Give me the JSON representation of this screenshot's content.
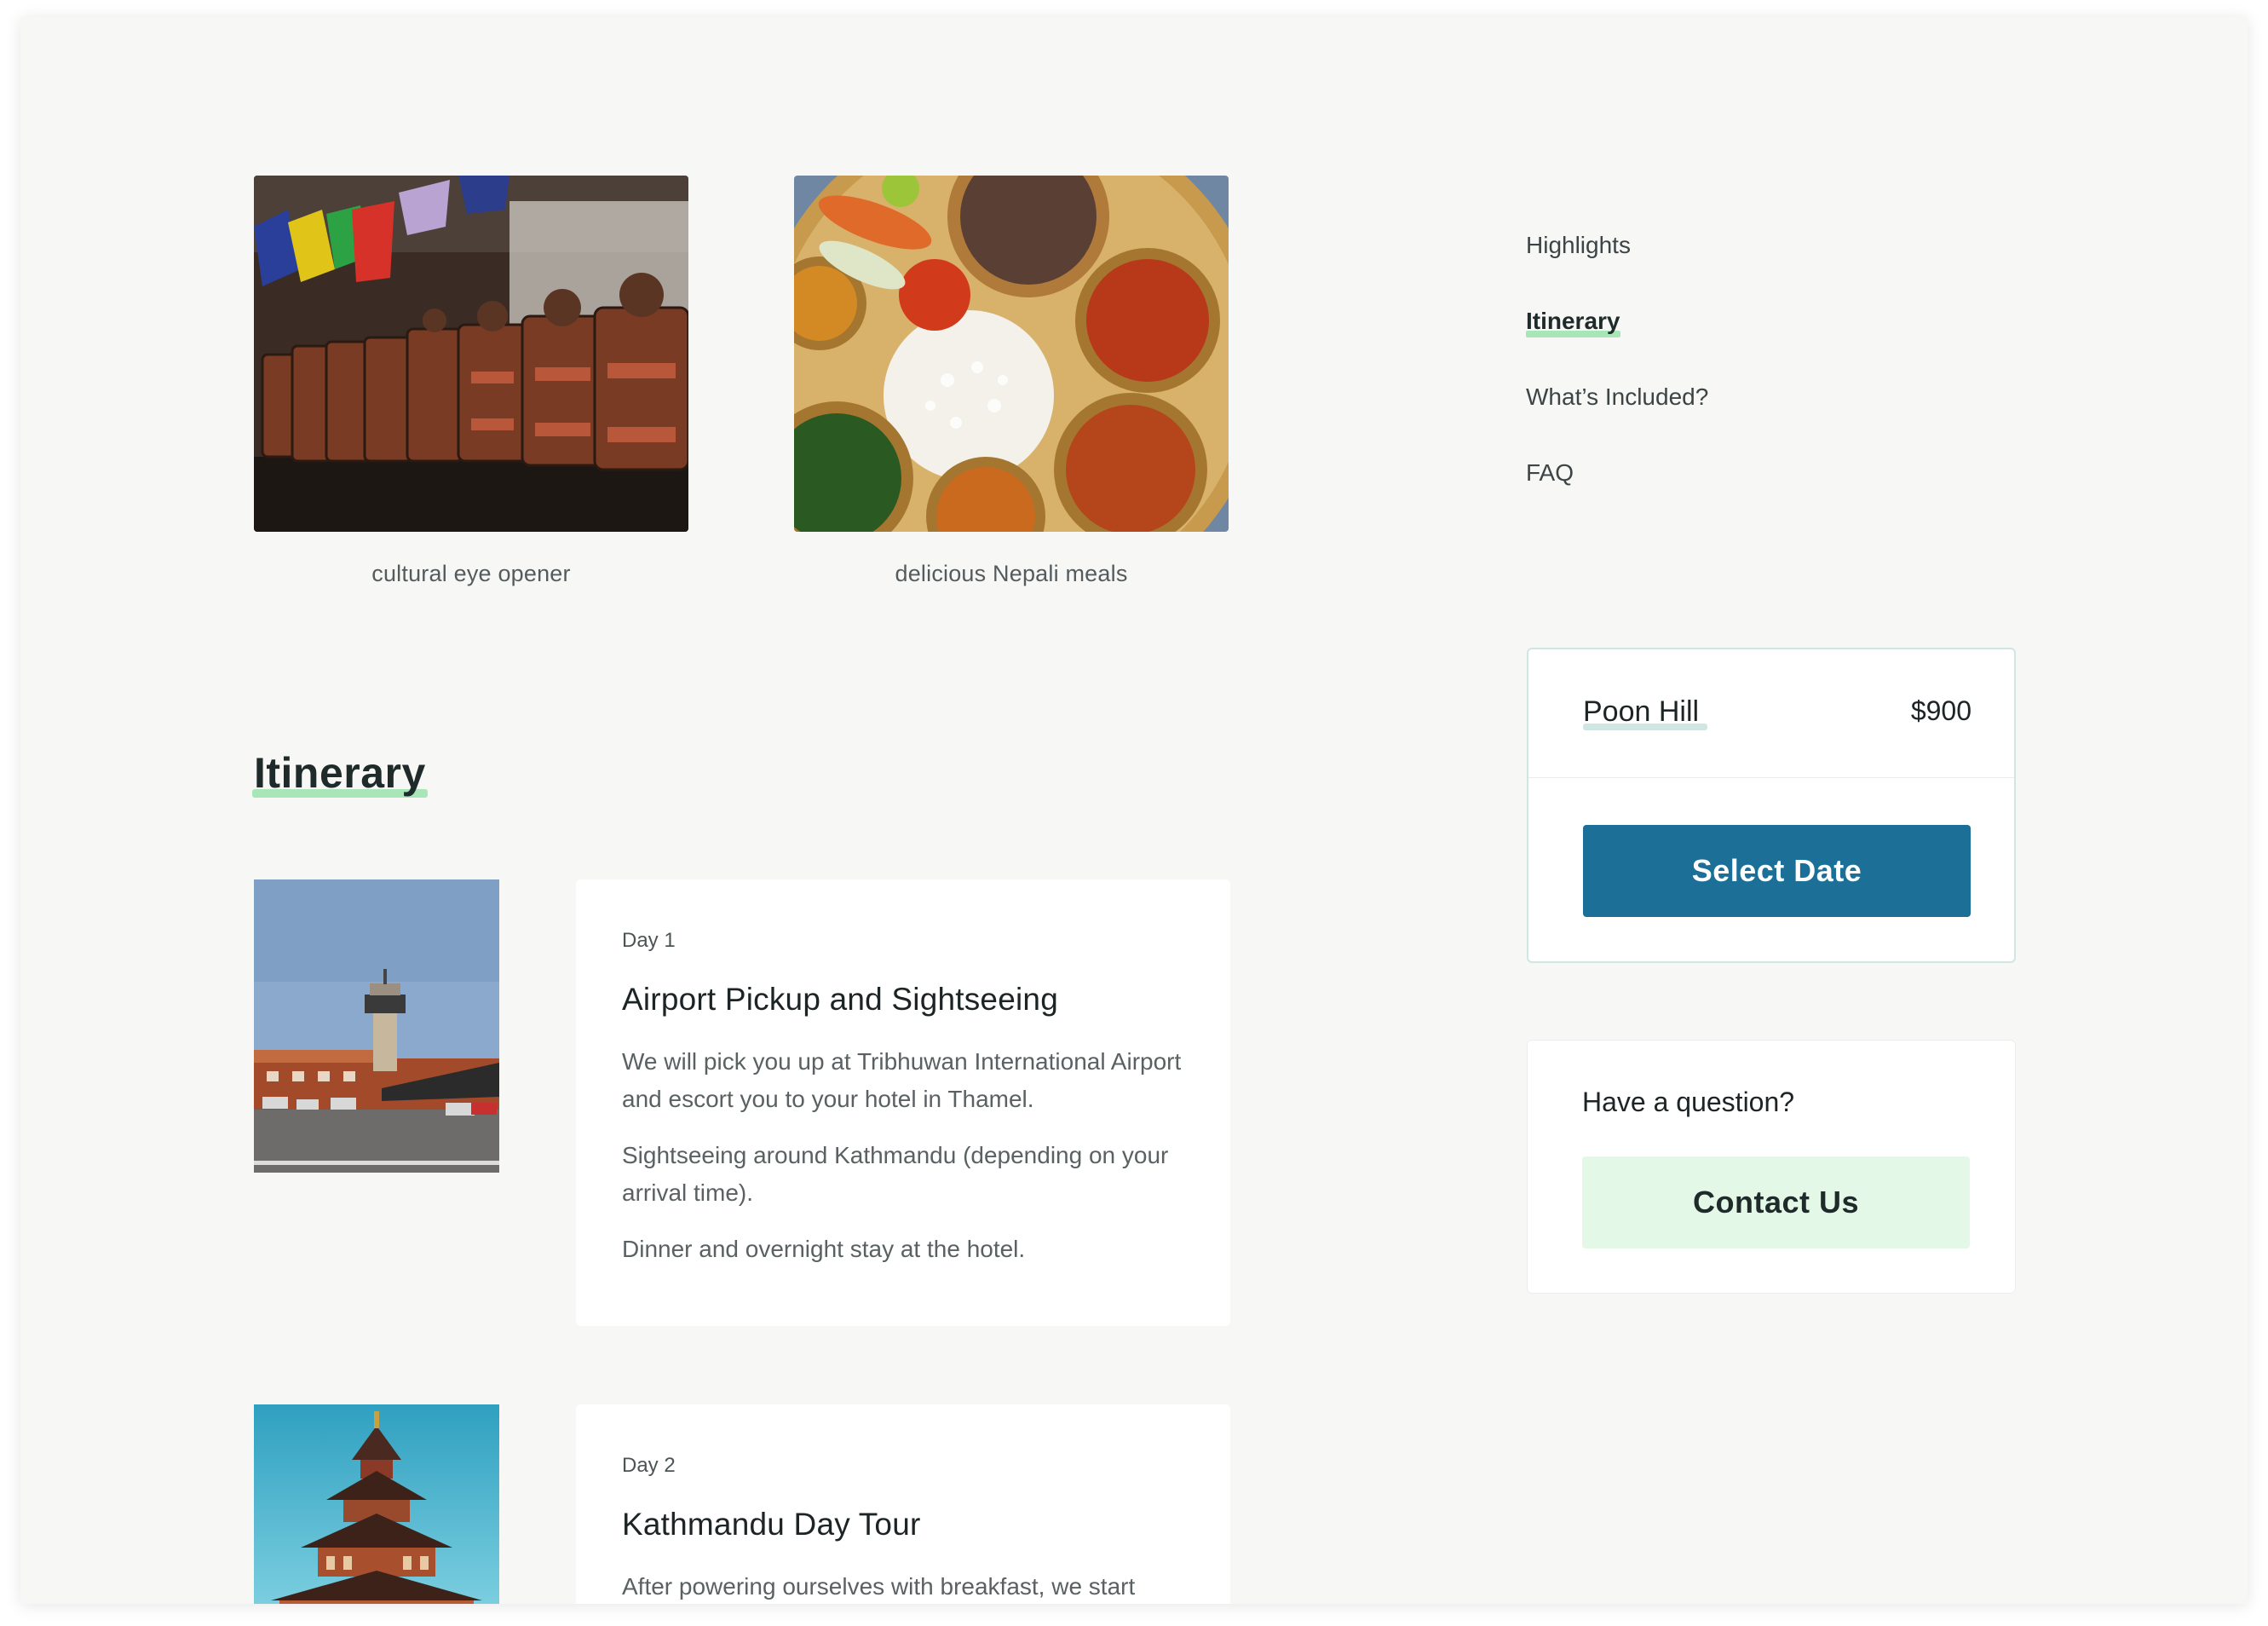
{
  "gallery": [
    {
      "caption": "cultural eye opener",
      "image": "prayer-wheels-photo"
    },
    {
      "caption": "delicious Nepali meals",
      "image": "nepali-thali-photo"
    }
  ],
  "itinerary": {
    "title": "Itinerary",
    "days": [
      {
        "label": "Day 1",
        "title": "Airport Pickup and Sightseeing",
        "image": "airport-tower-photo",
        "paragraphs": [
          "We will pick you up at Tribhuwan International Airport and escort you to your hotel in Thamel.",
          "Sightseeing around Kathmandu (depending on your arrival time).",
          "Dinner and overnight stay at the hotel."
        ]
      },
      {
        "label": "Day 2",
        "title": "Kathmandu Day Tour",
        "image": "pagoda-temple-photo",
        "paragraphs": [
          "After powering ourselves with breakfast, we start"
        ]
      }
    ]
  },
  "nav": {
    "items": [
      {
        "label": "Highlights",
        "active": false
      },
      {
        "label": "Itinerary",
        "active": true
      },
      {
        "label": "What’s Included?",
        "active": false
      },
      {
        "label": "FAQ",
        "active": false
      }
    ]
  },
  "booking": {
    "trip_name": "Poon Hill",
    "price": "$900",
    "select_date_label": "Select Date",
    "accent_color": "#1c6f96"
  },
  "question": {
    "title": "Have a question?",
    "contact_label": "Contact Us",
    "button_color": "#e4f8e7"
  },
  "colors": {
    "page_background": "#f7f8f6",
    "highlight": "#a8e6b8"
  }
}
